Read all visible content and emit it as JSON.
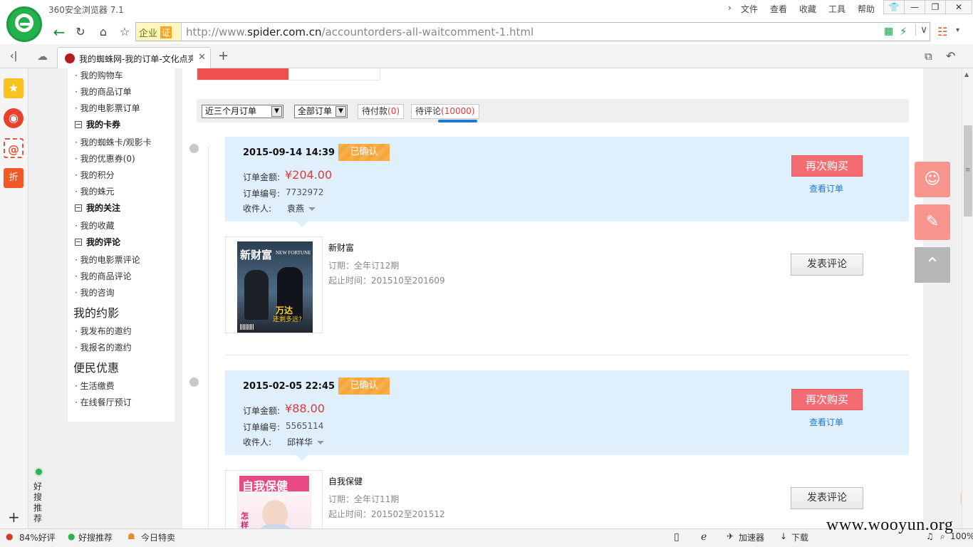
{
  "browser": {
    "app_title": "360安全浏览器 7.1",
    "menu": [
      "文件",
      "查看",
      "收藏",
      "工具",
      "帮助"
    ],
    "window_buttons": [
      "shirt",
      "—",
      "❐",
      "✕"
    ],
    "biz_label": "企业",
    "cert_label": "证",
    "url_prefix": "http://www.",
    "url_domain": "spider.com.cn",
    "url_path": "/accountorders-all-waitcomment-1.html",
    "tab_title": "我的蜘蛛网-我的订单-文化点亮",
    "new_tab": "+"
  },
  "left_nav": {
    "items_top": [
      "我的购物车",
      "我的商品订单",
      "我的电影票订单"
    ],
    "cards_head": "我的卡券",
    "cards_items": [
      "我的蜘蛛卡/观影卡",
      "我的优惠券(0)",
      "我的积分",
      "我的蛛元"
    ],
    "follow_head": "我的关注",
    "follow_items": [
      "我的收藏"
    ],
    "review_head": "我的评论",
    "review_items": [
      "我的电影票评论",
      "我的商品评论",
      "我的咨询"
    ],
    "yueying_title": "我的约影",
    "yueying_items": [
      "我发布的邀约",
      "我报名的邀约"
    ],
    "bianmin_title": "便民优惠",
    "bianmin_items": [
      "生活缴费",
      "在线餐厅预订"
    ]
  },
  "filter": {
    "period": "近三个月订单",
    "type": "全部订单",
    "pending_pay_label": "待付款",
    "pending_pay_count": "(0)",
    "pending_review_label": "待评论",
    "pending_review_count": "(10000)"
  },
  "labels": {
    "amount": "订单金额:",
    "number": "订单编号:",
    "receiver": "收件人:",
    "rebuy": "再次购买",
    "view_order": "查看订单",
    "review": "发表评论"
  },
  "orders": [
    {
      "date": "2015-09-14 14:39",
      "status": "已确认",
      "amount": "¥204.00",
      "number": "7732972",
      "receiver": "袁燕",
      "product_name": "新财富",
      "period": "订期：全年订12期",
      "range": "起止时间：201510至201609",
      "cover_title": "新财富",
      "cover_en": "NEW FORTUNE",
      "cover_headline": "万达",
      "cover_sub": "还剩多远?"
    },
    {
      "date": "2015-02-05 22:45",
      "status": "已确认",
      "amount": "¥88.00",
      "number": "5565114",
      "receiver": "邱祥华",
      "product_name": "自我保健",
      "period": "订期：全年订11期",
      "range": "起止时间：201502至201512",
      "cover_title": "自我保健",
      "cover_headline": "怎样减肥"
    }
  ],
  "recommend_label": "好搜推荐",
  "status_bar": {
    "rating": "84%好评",
    "recommend": "好搜推荐",
    "today": "今日特卖",
    "accelerator": "加速器",
    "download": "下载",
    "zoom": "100%"
  },
  "watermark": "www.wooyun.org",
  "colors": {
    "accent_red": "#e4393c",
    "rebuy_btn": "#f36d72",
    "order_head_bg": "#dfeffb",
    "status_badge": "#f8b04c",
    "link_blue": "#1f78d1",
    "float_tool": "#f8958e"
  }
}
